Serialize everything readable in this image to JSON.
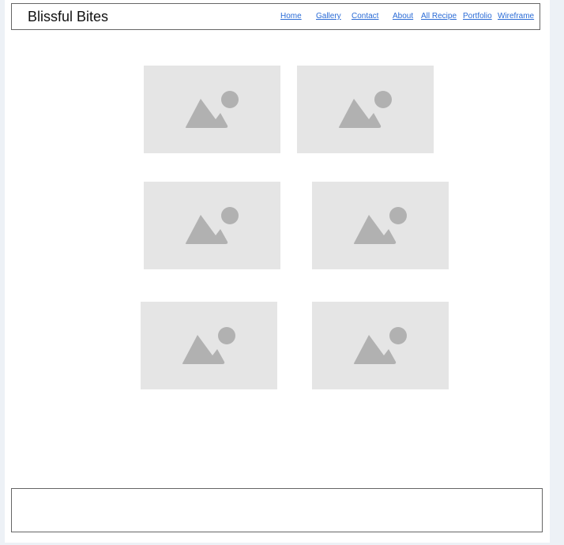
{
  "header": {
    "title": "Blissful Bites",
    "nav": {
      "home": "Home",
      "gallery": "Gallery",
      "contact": "Contact",
      "about": "About",
      "all_recipe": "All Recipe",
      "portfolio": "Portfolio",
      "wireframe": "Wireframe"
    }
  },
  "gallery": {
    "image_count": 6,
    "icon": "image-placeholder-icon"
  },
  "colors": {
    "link": "#2a6bd6",
    "placeholder_bg": "#e5e5e5",
    "placeholder_icon": "#b1b1b1",
    "border": "#666666"
  }
}
